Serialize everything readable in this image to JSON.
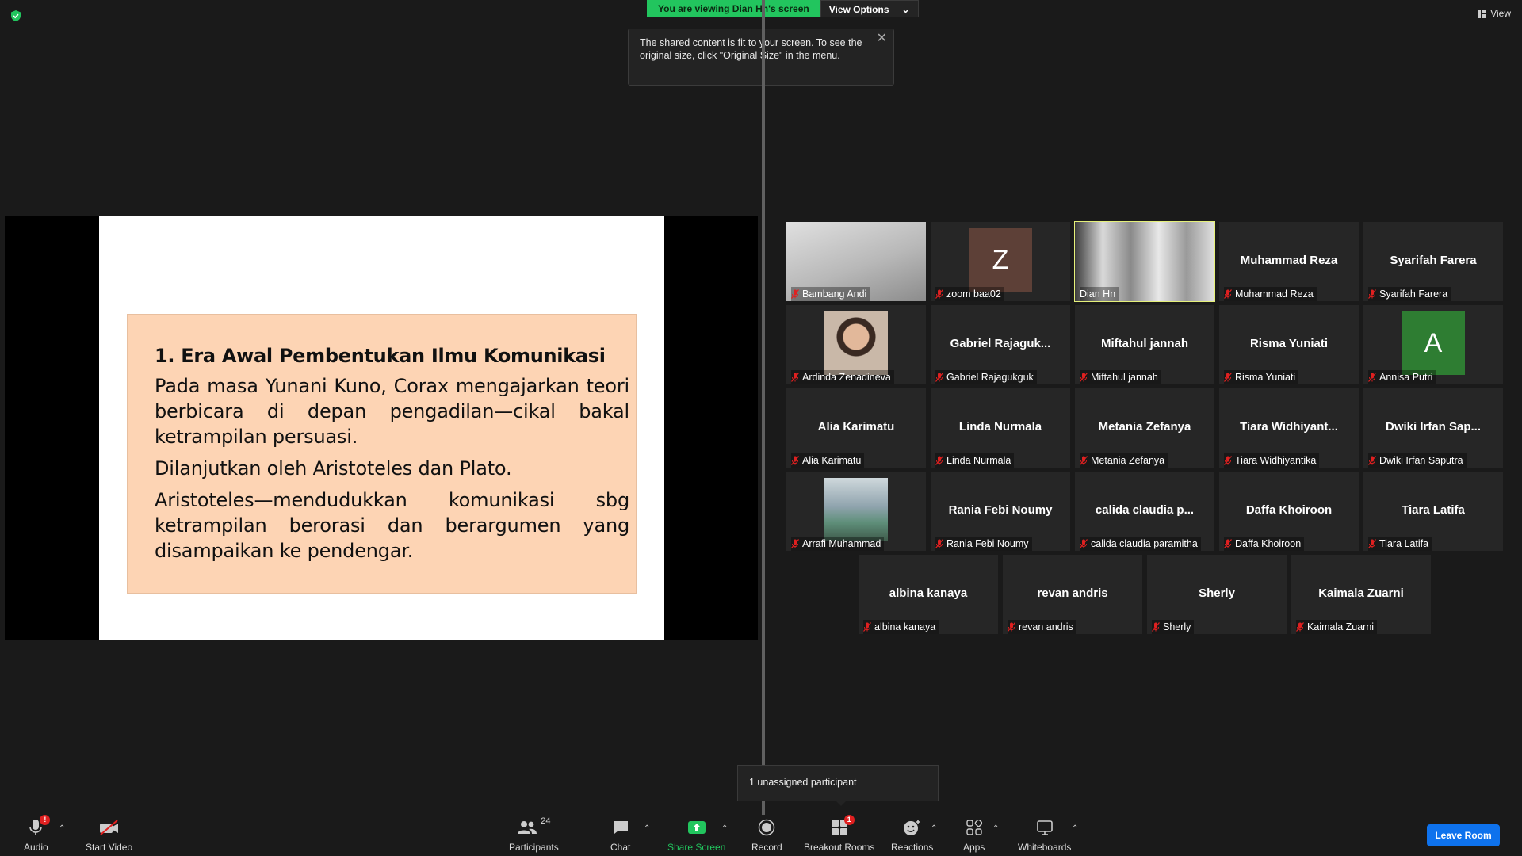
{
  "banner": {
    "viewing_text": "You are viewing Dian Hn's screen",
    "view_options": "View Options"
  },
  "tooltip": {
    "text": "The shared content is fit to your screen. To see the original size, click \"Original Size\" in the menu."
  },
  "view_label": "View",
  "slide": {
    "title": "1. Era Awal Pembentukan Ilmu Komunikasi",
    "p1": "Pada masa Yunani Kuno, Corax mengajarkan teori berbicara di depan pengadilan—cikal bakal ketrampilan persuasi.",
    "p2": "Dilanjutkan oleh Aristoteles dan Plato.",
    "p3": "Aristoteles—mendudukkan komunikasi sbg ketrampilan berorasi dan berargumen yang disampaikan ke pendengar."
  },
  "participants": [
    {
      "name": "Bambang Andi",
      "display": "",
      "type": "video"
    },
    {
      "name": "zoom baa02",
      "display": "Z",
      "type": "avatar",
      "color": "#5d4037"
    },
    {
      "name": "Dian Hn",
      "display": "",
      "type": "video",
      "active": true
    },
    {
      "name": "Muhammad Reza",
      "display": "Muhammad Reza",
      "type": "name"
    },
    {
      "name": "Syarifah Farera",
      "display": "Syarifah Farera",
      "type": "name"
    },
    {
      "name": "Ardinda Zenadineva",
      "display": "",
      "type": "photo"
    },
    {
      "name": "Gabriel Rajagukguk",
      "display": "Gabriel  Rajaguk...",
      "type": "name"
    },
    {
      "name": "Miftahul jannah",
      "display": "Miftahul jannah",
      "type": "name"
    },
    {
      "name": "Risma Yuniati",
      "display": "Risma Yuniati",
      "type": "name"
    },
    {
      "name": "Annisa Putri",
      "display": "A",
      "type": "avatar",
      "color": "#2e7d32"
    },
    {
      "name": "Alia Karimatu",
      "display": "Alia Karimatu",
      "type": "name"
    },
    {
      "name": "Linda Nurmala",
      "display": "Linda Nurmala",
      "type": "name"
    },
    {
      "name": "Metania Zefanya",
      "display": "Metania Zefanya",
      "type": "name"
    },
    {
      "name": "Tiara Widhiyantika",
      "display": "Tiara  Widhiyant...",
      "type": "name"
    },
    {
      "name": "Dwiki Irfan Saputra",
      "display": "Dwiki  Irfan  Sap...",
      "type": "name"
    },
    {
      "name": "Arrafi Muhammad",
      "display": "",
      "type": "photo2"
    },
    {
      "name": "Rania Febi Noumy",
      "display": "Rania Febi Noumy",
      "type": "name"
    },
    {
      "name": "calida claudia paramitha",
      "display": "calida  claudia  p...",
      "type": "name"
    },
    {
      "name": "Daffa Khoiroon",
      "display": "Daffa Khoiroon",
      "type": "name"
    },
    {
      "name": "Tiara Latifa",
      "display": "Tiara Latifa",
      "type": "name"
    },
    {
      "name": "albina kanaya",
      "display": "albina kanaya",
      "type": "name"
    },
    {
      "name": "revan andris",
      "display": "revan andris",
      "type": "name"
    },
    {
      "name": "Sherly",
      "display": "Sherly",
      "type": "name"
    },
    {
      "name": "Kaimala Zuarni",
      "display": "Kaimala Zuarni",
      "type": "name"
    }
  ],
  "popup": {
    "text": "1 unassigned participant"
  },
  "toolbar": {
    "audio": "Audio",
    "audio_badge": "!",
    "start_video": "Start Video",
    "participants": "Participants",
    "participants_count": "24",
    "chat": "Chat",
    "share_screen": "Share Screen",
    "record": "Record",
    "breakout_rooms": "Breakout Rooms",
    "breakout_badge": "1",
    "reactions": "Reactions",
    "apps": "Apps",
    "whiteboards": "Whiteboards",
    "leave_room": "Leave Room"
  },
  "colors": {
    "banner_green": "#22c55e",
    "active_speaker": "#e5f07a",
    "share_green": "#22c55e",
    "leave_blue": "#0e72ed",
    "mute_red": "#e02020",
    "slide_box": "#fdd4b4"
  }
}
